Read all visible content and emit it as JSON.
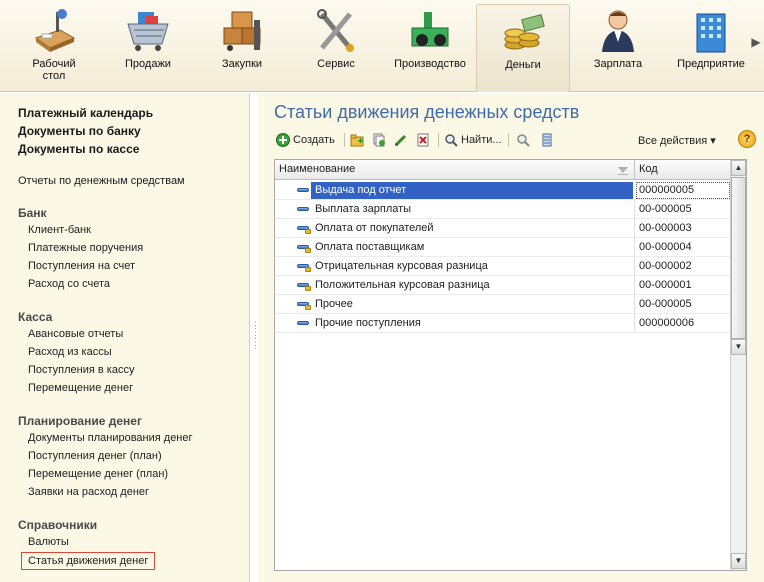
{
  "sections": [
    {
      "label": "Рабочий\nстол",
      "icon": "desktop-icon"
    },
    {
      "label": "Продажи",
      "icon": "cart-icon"
    },
    {
      "label": "Закупки",
      "icon": "boxes-icon"
    },
    {
      "label": "Сервис",
      "icon": "tools-icon"
    },
    {
      "label": "Производство",
      "icon": "factory-icon"
    },
    {
      "label": "Деньги",
      "icon": "coins-icon",
      "active": true
    },
    {
      "label": "Зарплата",
      "icon": "person-icon"
    },
    {
      "label": "Предприятие",
      "icon": "building-icon"
    }
  ],
  "nav": {
    "top_links": [
      "Платежный календарь",
      "Документы по банку",
      "Документы по кассе"
    ],
    "reports_link": "Отчеты по денежным средствам",
    "groups": [
      {
        "title": "Банк",
        "items": [
          "Клиент-банк",
          "Платежные поручения",
          "Поступления на счет",
          "Расход со счета"
        ]
      },
      {
        "title": "Касса",
        "items": [
          "Авансовые отчеты",
          "Расход из кассы",
          "Поступления в кассу",
          "Перемещение денег"
        ]
      },
      {
        "title": "Планирование денег",
        "items": [
          "Документы планирования денег",
          "Поступления денег (план)",
          "Перемещение денег (план)",
          "Заявки на расход денег"
        ]
      },
      {
        "title": "Справочники",
        "items": [
          "Валюты",
          "Статья движения денег"
        ]
      }
    ]
  },
  "main": {
    "title": "Статьи движения денежных средств",
    "toolbar": {
      "create_label": "Создать",
      "find_label": "Найти...",
      "all_actions_label": "Все действия ▾",
      "help_label": "?"
    },
    "table": {
      "columns": [
        "Наименование",
        "Код"
      ],
      "rows": [
        {
          "name": "Выдача под отчет",
          "code": "000000005",
          "selected": true
        },
        {
          "name": "Выплата зарплаты",
          "code": "00-000005"
        },
        {
          "name": "Оплата от покупателей",
          "code": "00-000003"
        },
        {
          "name": "Оплата поставщикам",
          "code": "00-000004"
        },
        {
          "name": "Отрицательная курсовая разница",
          "code": "00-000002"
        },
        {
          "name": "Положительная курсовая разница",
          "code": "00-000001"
        },
        {
          "name": "Прочее",
          "code": "00-000005"
        },
        {
          "name": "Прочие поступления",
          "code": "000000006"
        }
      ]
    }
  },
  "colors": {
    "title_blue": "#3f6ba8",
    "selection_blue": "#3162c4",
    "nav_bg": "#fbf8e6",
    "highlight_red": "#e0453a"
  }
}
